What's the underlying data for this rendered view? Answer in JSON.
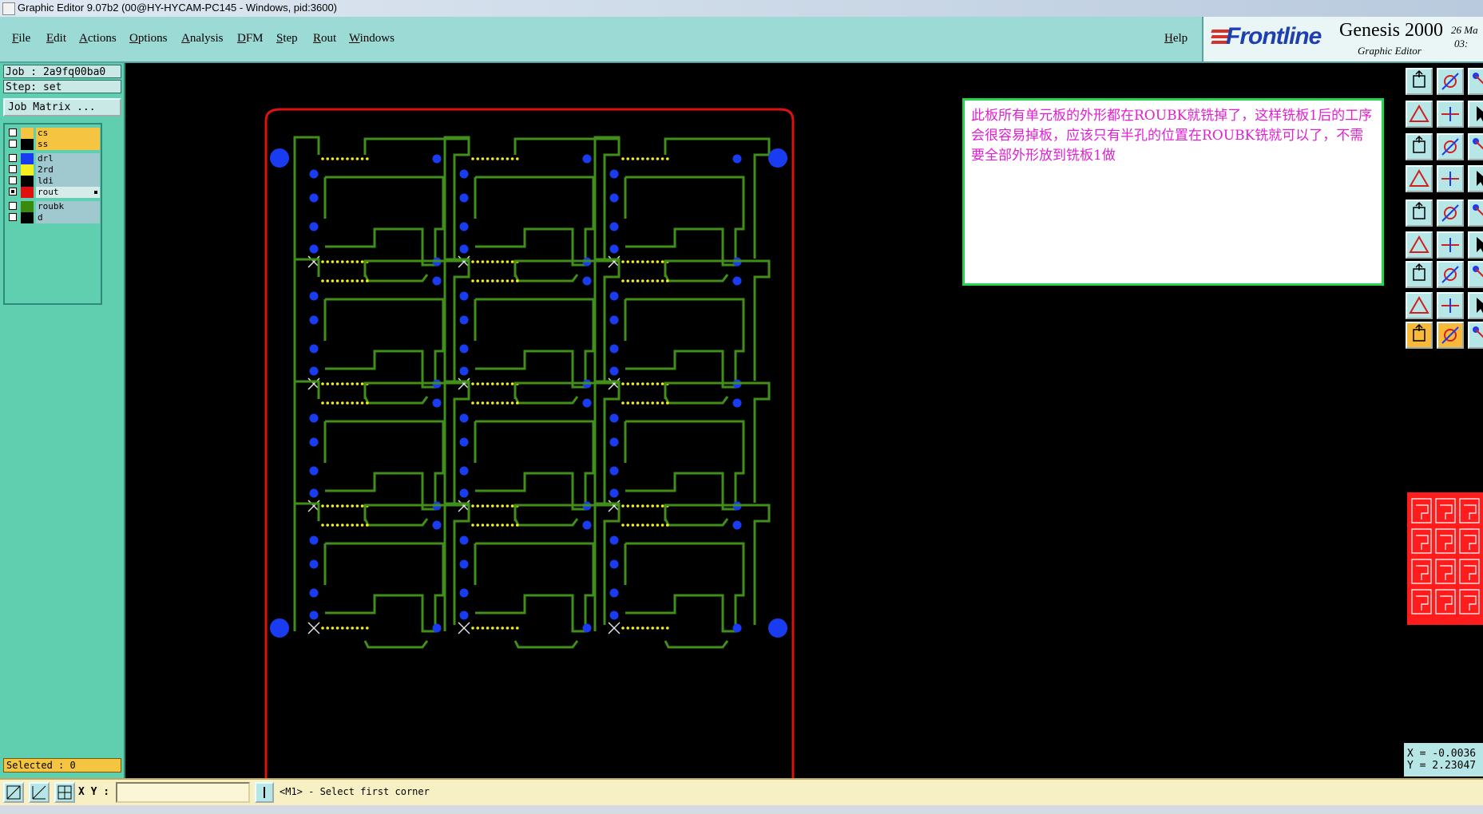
{
  "window": {
    "title": "Graphic Editor 9.07b2 (00@HY-HYCAM-PC145 - Windows, pid:3600)"
  },
  "menu": {
    "items": [
      "File",
      "Edit",
      "Actions",
      "Options",
      "Analysis",
      "DFM",
      "Step",
      "Rout",
      "Windows"
    ],
    "help": "Help"
  },
  "brand": {
    "logo": "Frontline",
    "product": "Genesis 2000",
    "subtitle": "Graphic Editor",
    "clock_line1": "26 Ma",
    "clock_line2": "03:"
  },
  "job_panel": {
    "job": "Job : 2a9fq00ba0",
    "step": "Step: set",
    "job_matrix_button": "Job Matrix ...",
    "layers": [
      {
        "name": "cs",
        "color": "#f5c542",
        "bg": "#f5c542",
        "checked": false,
        "active": false
      },
      {
        "name": "ss",
        "color": "#000000",
        "bg": "#f5c542",
        "checked": false,
        "active": false
      },
      {
        "name": "drl",
        "color": "#1a3cf0",
        "bg": "#9fc9cf",
        "checked": false,
        "active": false
      },
      {
        "name": "2rd",
        "color": "#f2ee20",
        "bg": "#9fc9cf",
        "checked": false,
        "active": false
      },
      {
        "name": "ldi",
        "color": "#000000",
        "bg": "#9fc9cf",
        "checked": false,
        "active": false
      },
      {
        "name": "rout",
        "color": "#e01010",
        "bg": "#d6ecea",
        "checked": true,
        "active": true
      },
      {
        "name": "roubk",
        "color": "#3a8a10",
        "bg": "#9fc9cf",
        "checked": false,
        "active": false
      },
      {
        "name": "d",
        "color": "#000000",
        "bg": "#9fc9cf",
        "checked": false,
        "active": false
      }
    ],
    "selected": "Selected : 0"
  },
  "note": {
    "text": "此板所有单元板的外形都在ROUBK就铣掉了，这样铣板1后的工序会很容易掉板，应该只有半孔的位置在ROUBK铣就可以了，不需要全部外形放到铣板1做"
  },
  "coordinates": {
    "x": "X = -0.0036",
    "y": "Y = 2.23047"
  },
  "bottom": {
    "xy_label": "X Y :",
    "xy_value": "",
    "status": "<M1> - Select first corner"
  },
  "colors": {
    "rout_outline": "#e01010",
    "roubk_path": "#3f8f1a",
    "drill": "#1a3cf0",
    "second_drill": "#f2ee20",
    "note_text": "#e01fd2",
    "note_border": "#22d64a"
  },
  "icons": {
    "tool_buttons": [
      "move-up-icon",
      "move-down-icon",
      "copy-icon",
      "move-left-icon",
      "move-right-icon",
      "mirror-icon",
      "fit-icon",
      "pan-icon",
      "rotate-icon",
      "wave-icon",
      "grid-icon",
      "panel-icon",
      "camera-icon",
      "line-edit-icon",
      "info-icon",
      "connect-icon",
      "cross-icon",
      "node-icon",
      "draw-line-icon",
      "arc-icon",
      "angle-icon",
      "pad-icon",
      "dash-icon",
      "shift-icon",
      "triangle-icon",
      "arrow-triangle-icon",
      "measure-icon",
      "pointer-icon",
      "select-icon",
      "reset-icon"
    ]
  }
}
